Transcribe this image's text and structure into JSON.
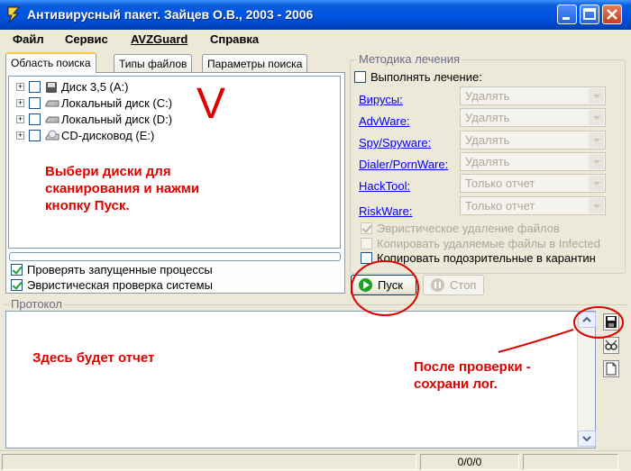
{
  "window": {
    "title": "Антивирусный пакет. Зайцев О.В., 2003 - 2006",
    "controls": [
      "minimize-icon",
      "maximize-icon",
      "close-icon"
    ]
  },
  "menu": [
    "Файл",
    "Сервис",
    "AVZGuard",
    "Справка"
  ],
  "tabs": [
    "Область поиска",
    "Типы файлов",
    "Параметры поиска"
  ],
  "drives": [
    {
      "label": "Диск 3,5 (A:)",
      "icon": "floppy-icon"
    },
    {
      "label": "Локальный диск (C:)",
      "icon": "hdd-icon"
    },
    {
      "label": "Локальный диск (D:)",
      "icon": "hdd-icon"
    },
    {
      "label": "CD-дисковод (E:)",
      "icon": "cdrom-icon"
    }
  ],
  "scan_options": [
    {
      "label": "Проверять запущенные процессы",
      "checked": true
    },
    {
      "label": "Эвристическая проверка системы",
      "checked": true
    }
  ],
  "treatment": {
    "group_title": "Методика лечения",
    "perform_label": "Выполнять лечение:",
    "rows": [
      {
        "link": "Вирусы:",
        "value": "Удалять"
      },
      {
        "link": "AdvWare:",
        "value": "Удалять"
      },
      {
        "link": "Spy/Spyware:",
        "value": "Удалять"
      },
      {
        "link": "Dialer/PornWare:",
        "value": "Удалять"
      },
      {
        "link": "HackTool:",
        "value": "Только отчет"
      },
      {
        "link": "RiskWare:",
        "value": "Только отчет"
      }
    ],
    "options": [
      {
        "label": "Эвристическое удаление файлов",
        "checked": true
      },
      {
        "label": "Копировать удаляемые файлы в  Infected",
        "checked": false
      },
      {
        "label": "Копировать подозрительные в  карантин",
        "checked": false
      }
    ]
  },
  "buttons": {
    "start": "Пуск",
    "stop": "Стоп"
  },
  "protocol_title": "Протокол",
  "status": {
    "counter": "0/0/0"
  },
  "annotations": {
    "v_mark": "V",
    "select_drives": "Выбери диски для\nсканирования и нажми\nкнопку Пуск.",
    "report_here": "Здесь будет отчет",
    "save_log": "После проверки -\nсохрани лог."
  },
  "colors": {
    "annotation": "#e00000",
    "title_bar": "#0054e3",
    "link": "#0000ee"
  }
}
